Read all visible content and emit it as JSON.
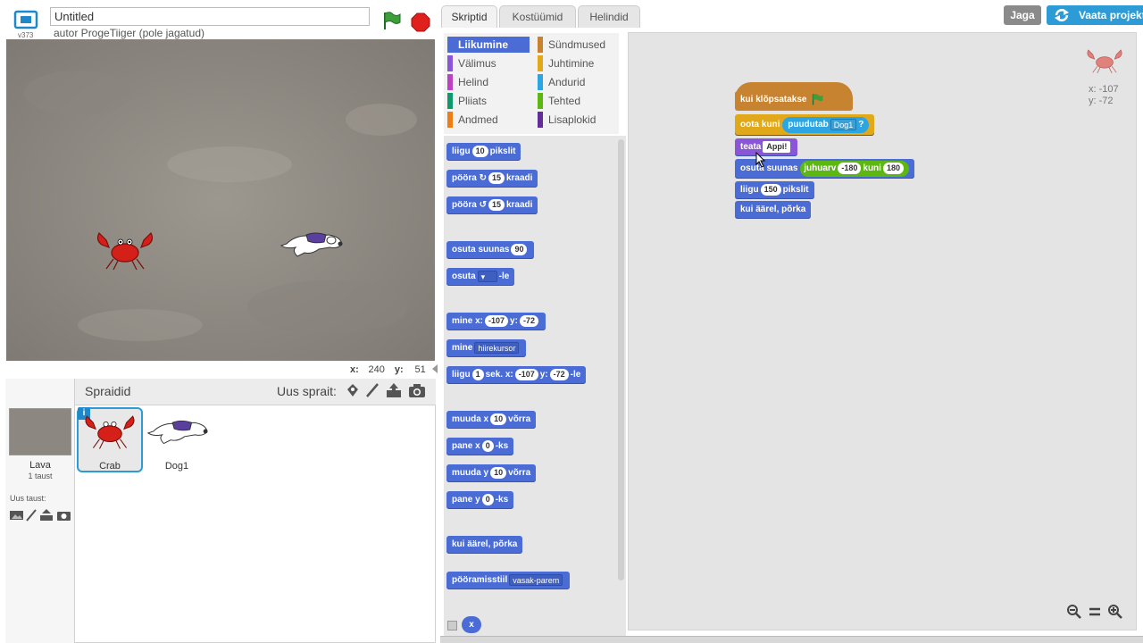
{
  "window": {
    "version": "v373",
    "title_value": "Untitled",
    "author": "autor ProgeTiiger (pole jagatud)"
  },
  "tabs": [
    "Skriptid",
    "Kostüümid",
    "Helindid"
  ],
  "header": {
    "share": "Jaga",
    "view_project": "Vaata projekti"
  },
  "stage": {
    "x_label": "x:",
    "x_value": "240",
    "y_label": "y:",
    "y_value": "51"
  },
  "sprites": {
    "title": "Spraidid",
    "new_sprite": "Uus sprait:",
    "stage_label": "Lava",
    "stage_sub": "1 taust",
    "new_backdrop": "Uus taust:",
    "items": [
      {
        "name": "Crab",
        "info": "i"
      },
      {
        "name": "Dog1"
      }
    ]
  },
  "categories": [
    {
      "label": "Liikumine",
      "color": "#4a6cd4"
    },
    {
      "label": "Sündmused",
      "color": "#c88330"
    },
    {
      "label": "Välimus",
      "color": "#8a55d7"
    },
    {
      "label": "Juhtimine",
      "color": "#e1a91a"
    },
    {
      "label": "Helind",
      "color": "#bb42c3"
    },
    {
      "label": "Andurid",
      "color": "#2ca5e2"
    },
    {
      "label": "Pliiats",
      "color": "#0e9a6c"
    },
    {
      "label": "Tehted",
      "color": "#5cb712"
    },
    {
      "label": "Andmed",
      "color": "#ee7d16"
    },
    {
      "label": "Lisaplokid",
      "color": "#632d99"
    }
  ],
  "palette": {
    "move": {
      "a": "liigu",
      "n": "10",
      "b": "pikslit"
    },
    "turn_r": {
      "a": "pööra",
      "n": "15",
      "b": "kraadi",
      "icon": "rotate-right-icon"
    },
    "turn_l": {
      "a": "pööra",
      "n": "15",
      "b": "kraadi",
      "icon": "rotate-left-icon"
    },
    "point_dir": {
      "a": "osuta suunas",
      "n": "90"
    },
    "point_to": {
      "a": "osuta",
      "b": "-le"
    },
    "goto_xy": {
      "a": "mine x:",
      "x": "-107",
      "ya": "y:",
      "y": "-72"
    },
    "goto": {
      "a": "mine",
      "dd": "hiirekursor"
    },
    "glide": {
      "a": "liigu",
      "n": "1",
      "b": "sek. x:",
      "x": "-107",
      "ya": "y:",
      "y": "-72",
      "c": "-le"
    },
    "change_x": {
      "a": "muuda x",
      "n": "10",
      "b": "võrra"
    },
    "set_x": {
      "a": "pane x",
      "n": "0",
      "b": "-ks"
    },
    "change_y": {
      "a": "muuda y",
      "n": "10",
      "b": "võrra"
    },
    "set_y": {
      "a": "pane y",
      "n": "0",
      "b": "-ks"
    },
    "bounce": {
      "a": "kui äärel, põrka"
    },
    "rotation": {
      "a": "pööramisstiil",
      "dd": "vasak-parem"
    },
    "reporter": {
      "a": "x"
    }
  },
  "script": {
    "hat": "kui klõpsatakse",
    "wait_until": {
      "a": "oota kuni",
      "b": "puudutab",
      "dd": "Dog1",
      "q": "?"
    },
    "say": {
      "a": "teata",
      "dd": "Appi!"
    },
    "point_dir": {
      "a": "osuta suunas",
      "b": "juhuarv",
      "n1": "-180",
      "c": "kuni",
      "n2": "180"
    },
    "move": {
      "a": "liigu",
      "n": "150",
      "b": "pikslit"
    },
    "bounce": {
      "a": "kui äärel, põrka"
    }
  },
  "sprite_info": {
    "x": "x: -107",
    "y": "y: -72"
  },
  "colors": {
    "motion": "#4a6cd4",
    "events": "#c88330",
    "control": "#e1a91a",
    "sensing": "#2ca5e2",
    "operators": "#5cb712",
    "looks": "#8a55d7"
  }
}
